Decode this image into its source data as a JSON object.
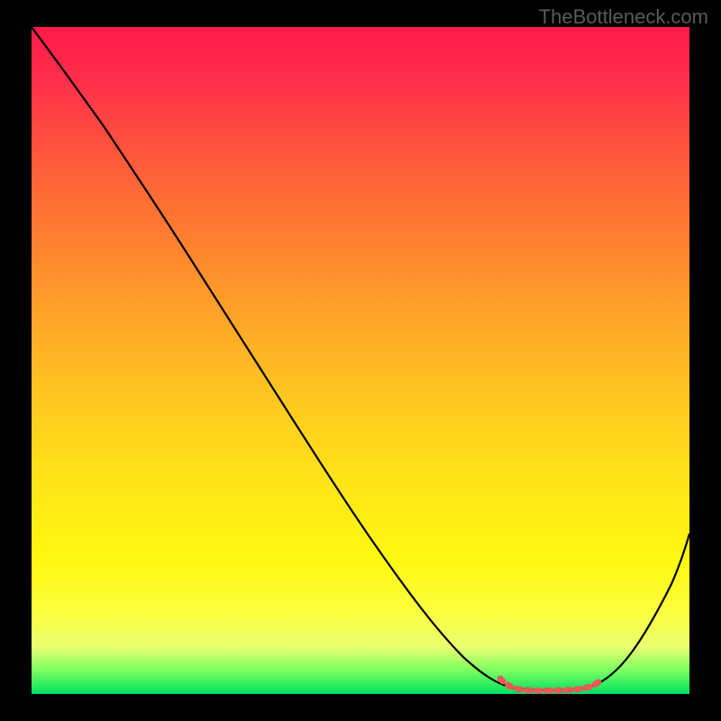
{
  "watermark": "TheBottleneck.com",
  "chart_data": {
    "type": "line",
    "title": "",
    "xlabel": "",
    "ylabel": "",
    "xlim": [
      0,
      100
    ],
    "ylim": [
      0,
      100
    ],
    "x": [
      0,
      5,
      10,
      15,
      20,
      25,
      30,
      35,
      40,
      45,
      50,
      55,
      60,
      65,
      70,
      72,
      74,
      76,
      78,
      80,
      82,
      84,
      86,
      88,
      90,
      92,
      94,
      96,
      98,
      100
    ],
    "values": [
      100,
      95,
      89,
      83,
      76,
      69,
      62,
      55,
      48,
      41,
      34,
      27,
      20,
      13,
      6,
      3.5,
      2,
      1,
      0.6,
      0.5,
      0.5,
      0.5,
      0.7,
      1.3,
      3,
      6,
      10,
      15,
      21,
      28
    ],
    "optimal_zone": {
      "x_start": 71,
      "x_end": 86,
      "y": 0.7
    },
    "annotations": [],
    "background_gradient": "vertical red-to-green"
  }
}
